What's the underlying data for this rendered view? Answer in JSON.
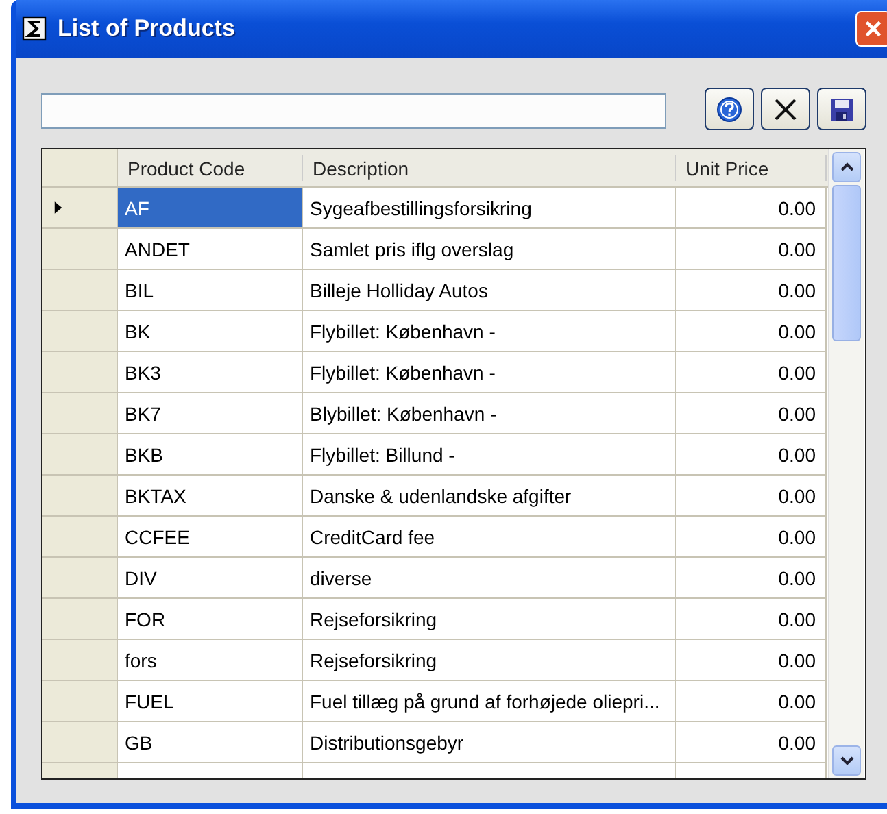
{
  "window": {
    "title": "List of Products"
  },
  "table": {
    "columns": [
      "Product Code",
      "Description",
      "Unit Price"
    ],
    "rows": [
      {
        "code": "AF",
        "description": "Sygeafbestillingsforsikring",
        "price": "0.00",
        "selected": true
      },
      {
        "code": "ANDET",
        "description": "Samlet pris iflg overslag",
        "price": "0.00",
        "selected": false
      },
      {
        "code": "BIL",
        "description": "Billeje Holliday Autos",
        "price": "0.00",
        "selected": false
      },
      {
        "code": "BK",
        "description": "Flybillet: København -",
        "price": "0.00",
        "selected": false
      },
      {
        "code": "BK3",
        "description": "Flybillet: København -",
        "price": "0.00",
        "selected": false
      },
      {
        "code": "BK7",
        "description": "Blybillet: København -",
        "price": "0.00",
        "selected": false
      },
      {
        "code": "BKB",
        "description": "Flybillet: Billund -",
        "price": "0.00",
        "selected": false
      },
      {
        "code": "BKTAX",
        "description": "Danske & udenlandske afgifter",
        "price": "0.00",
        "selected": false
      },
      {
        "code": "CCFEE",
        "description": "CreditCard fee",
        "price": "0.00",
        "selected": false
      },
      {
        "code": "DIV",
        "description": "diverse",
        "price": "0.00",
        "selected": false
      },
      {
        "code": "FOR",
        "description": "Rejseforsikring",
        "price": "0.00",
        "selected": false
      },
      {
        "code": "fors",
        "description": "Rejseforsikring",
        "price": "0.00",
        "selected": false
      },
      {
        "code": "FUEL",
        "description": "Fuel tillæg på grund af forhøjede oliepri...",
        "price": "0.00",
        "selected": false
      },
      {
        "code": "GB",
        "description": "Distributionsgebyr",
        "price": "0.00",
        "selected": false
      }
    ]
  }
}
